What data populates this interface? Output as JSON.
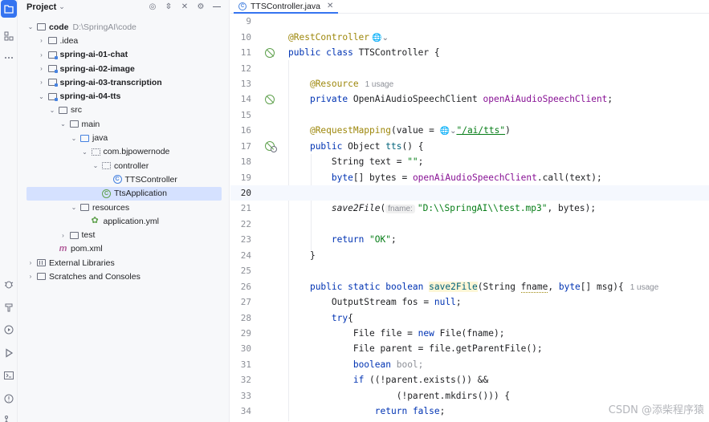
{
  "activity_bar": {
    "top": [
      "project-icon",
      "structure-icon",
      "more-icon"
    ],
    "bottom": [
      "debug-icon",
      "build-icon",
      "services-icon",
      "run-icon",
      "terminal-icon",
      "problems-icon",
      "git-icon"
    ]
  },
  "project_panel": {
    "title": "Project",
    "tools": [
      "target-icon",
      "expand-icon",
      "close-icon",
      "gear-icon",
      "minimize-icon"
    ],
    "tree": [
      {
        "label": "code",
        "path": "D:\\SpringAI\\code",
        "depth": 0,
        "expanded": true,
        "icon": "folder",
        "bold": true
      },
      {
        "label": ".idea",
        "depth": 1,
        "expanded": false,
        "icon": "folder"
      },
      {
        "label": "spring-ai-01-chat",
        "depth": 1,
        "expanded": false,
        "icon": "module",
        "bold": true
      },
      {
        "label": "spring-ai-02-image",
        "depth": 1,
        "expanded": false,
        "icon": "module",
        "bold": true
      },
      {
        "label": "spring-ai-03-transcription",
        "depth": 1,
        "expanded": false,
        "icon": "module",
        "bold": true
      },
      {
        "label": "spring-ai-04-tts",
        "depth": 1,
        "expanded": true,
        "icon": "module",
        "bold": true
      },
      {
        "label": "src",
        "depth": 2,
        "expanded": true,
        "icon": "folder"
      },
      {
        "label": "main",
        "depth": 3,
        "expanded": true,
        "icon": "folder"
      },
      {
        "label": "java",
        "depth": 4,
        "expanded": true,
        "icon": "source-folder"
      },
      {
        "label": "com.bjpowernode",
        "depth": 5,
        "expanded": true,
        "icon": "package"
      },
      {
        "label": "controller",
        "depth": 6,
        "expanded": true,
        "icon": "package"
      },
      {
        "label": "TTSController",
        "depth": 7,
        "icon": "class"
      },
      {
        "label": "TtsApplication",
        "depth": 6,
        "icon": "spring-class",
        "selected": true
      },
      {
        "label": "resources",
        "depth": 4,
        "expanded": true,
        "icon": "folder"
      },
      {
        "label": "application.yml",
        "depth": 5,
        "icon": "yml"
      },
      {
        "label": "test",
        "depth": 3,
        "expanded": false,
        "icon": "folder"
      },
      {
        "label": "pom.xml",
        "depth": 2,
        "icon": "maven"
      },
      {
        "label": "External Libraries",
        "depth": 0,
        "expanded": false,
        "icon": "libraries"
      },
      {
        "label": "Scratches and Consoles",
        "depth": 0,
        "expanded": false,
        "icon": "scratches"
      }
    ]
  },
  "editor": {
    "tab_label": "TTSController.java",
    "line_numbers": [
      "9",
      "10",
      "11",
      "12",
      "13",
      "14",
      "15",
      "16",
      "17",
      "18",
      "19",
      "20",
      "21",
      "22",
      "23",
      "24",
      "25",
      "26",
      "27",
      "28",
      "29",
      "30",
      "31",
      "32",
      "33",
      "34"
    ],
    "code": {
      "l10_ann": "@RestController",
      "l11": [
        "public",
        " ",
        "class",
        " TTSController {"
      ],
      "l13_ann": "@Resource",
      "l13_hint": "1 usage",
      "l14_kw": "private",
      "l14_type": " OpenAiAudioSpeechClient ",
      "l14_field": "openAiAudioSpeechClient",
      "l14_end": ";",
      "l16_ann": "@RequestMapping",
      "l16_a": "(value = ",
      "l16_str": "\"/ai/tts\"",
      "l16_b": ")",
      "l17_kw": "public",
      "l17_rest": " Object ",
      "l17_fn": "tts",
      "l17_end": "() {",
      "l18_a": "String text = ",
      "l18_str": "\"\"",
      "l18_b": ";",
      "l19_kw": "byte",
      "l19_a": "[] bytes = ",
      "l19_field": "openAiAudioSpeechClient",
      "l19_b": ".call(text);",
      "l21_fn": "save2File",
      "l21_a": "(",
      "l21_inlay": "fname:",
      "l21_str": "\"D:\\\\SpringAI\\\\test.mp3\"",
      "l21_b": ", bytes);",
      "l23_kw": "return",
      "l23_str": " \"OK\"",
      "l23_b": ";",
      "l24": "}",
      "l26_kw": "public static boolean",
      "l26_fn": "save2File",
      "l26_a": "(String ",
      "l26_p": "fname",
      "l26_b": ", ",
      "l26_kw2": "byte",
      "l26_c": "[] msg){",
      "l26_hint": "1 usage",
      "l27_a": "OutputStream fos = ",
      "l27_kw": "null",
      "l27_b": ";",
      "l28_kw": "try",
      "l28_b": "{",
      "l29_a": "File file = ",
      "l29_kw": "new",
      "l29_b": " File(fname);",
      "l30": "File parent = file.getParentFile();",
      "l31_kw": "boolean",
      "l31_b": " bool;",
      "l32_kw": "if",
      "l32_b": " ((!parent.exists()) &&",
      "l33": "(!parent.mkdirs())) {",
      "l34_kw": "return",
      "l34_kw2": " false",
      "l34_b": ";"
    }
  },
  "watermark": "CSDN @添柴程序猿"
}
